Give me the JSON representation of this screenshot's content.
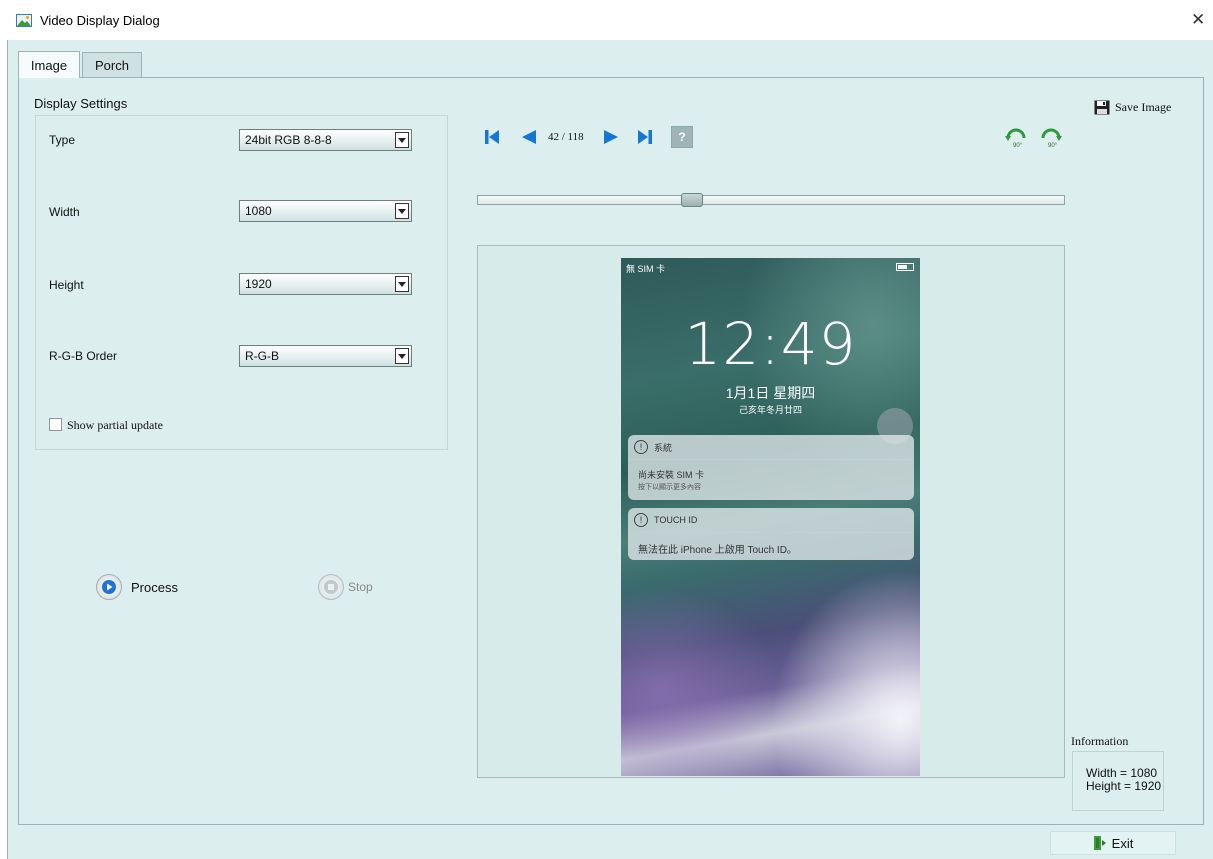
{
  "window": {
    "title": "Video Display Dialog",
    "close_glyph": "✕"
  },
  "tabs": [
    {
      "label": "Image"
    },
    {
      "label": "Porch"
    }
  ],
  "display_settings": {
    "label": "Display Settings",
    "type": {
      "label": "Type",
      "value": "24bit RGB 8-8-8"
    },
    "width": {
      "label": "Width",
      "value": "1080"
    },
    "height": {
      "label": "Height",
      "value": "1920"
    },
    "rgb_order": {
      "label": "R-G-B Order",
      "value": "R-G-B"
    },
    "show_partial_update": {
      "label": "Show partial update",
      "checked": false
    }
  },
  "actions": {
    "process_label": "Process",
    "stop_label": "Stop"
  },
  "navigation": {
    "counter": "42 / 118",
    "help_glyph": "?",
    "rotate_left_label": "90°",
    "rotate_right_label": "90°",
    "slider_position": 0.36
  },
  "save": {
    "label": "Save Image"
  },
  "preview": {
    "status_carrier": "無 SIM 卡",
    "time": "12:49",
    "date": "1月1日 星期四",
    "lunar_date": "己亥年冬月廿四",
    "notifications": [
      {
        "app": "系統",
        "title": "尚未安裝 SIM 卡",
        "subtitle": "按下以顯示更多內容"
      },
      {
        "app": "TOUCH ID",
        "body": "無法在此 iPhone 上啟用 Touch ID。"
      }
    ]
  },
  "information": {
    "label": "Information",
    "width_line": "Width = 1080",
    "height_line": "Height = 1920"
  },
  "exit": {
    "label": "Exit"
  },
  "colors": {
    "accent_blue": "#1d74d6",
    "nav_blue": "#1577d4",
    "rotate_green": "#2e9a3e"
  }
}
